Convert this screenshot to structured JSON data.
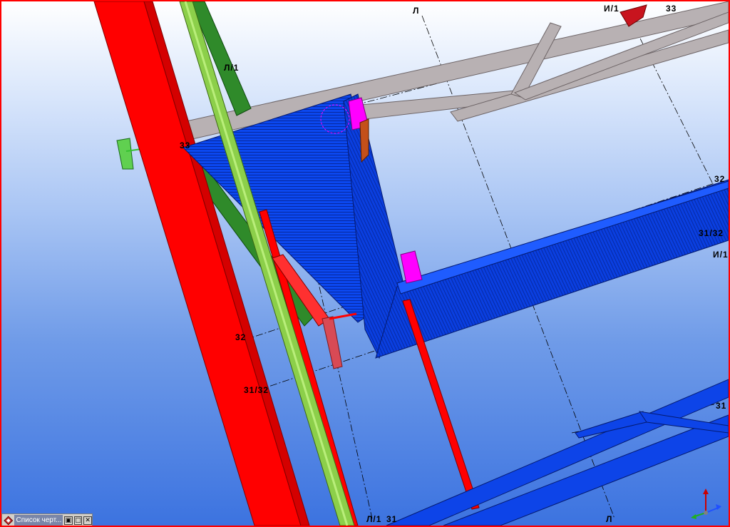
{
  "viewport": {
    "frame_color": "#ff0000",
    "grid_labels": {
      "l_top": "Л",
      "i1_top": "И/1",
      "n33_top": "33",
      "l1_upper": "Л/1",
      "n33_left": "33",
      "n32_right": "32",
      "n31_32_right": "31/32",
      "i1_right": "И/1",
      "n32_left": "32",
      "n31_32_left": "31/32",
      "n31_right": "31",
      "l1_bottom": "Л/1",
      "n31_bottom": "31",
      "l_bottom": "Л"
    }
  },
  "colors": {
    "column_red": "#ff0000",
    "pipe_green": "#7ab83a",
    "brace_green": "#2f8a2a",
    "truss_grey": "#b4aeb0",
    "beam_blue": "#0a3fe6",
    "plate_magenta": "#ff00ff"
  },
  "taskbar": {
    "title": "Список черт...",
    "icon": "app-icon",
    "restore_icon": "restore-icon",
    "maximize_icon": "maximize-icon",
    "close_icon": "close-icon"
  },
  "axis_gizmo": {
    "icon": "axis-gizmo-icon"
  }
}
